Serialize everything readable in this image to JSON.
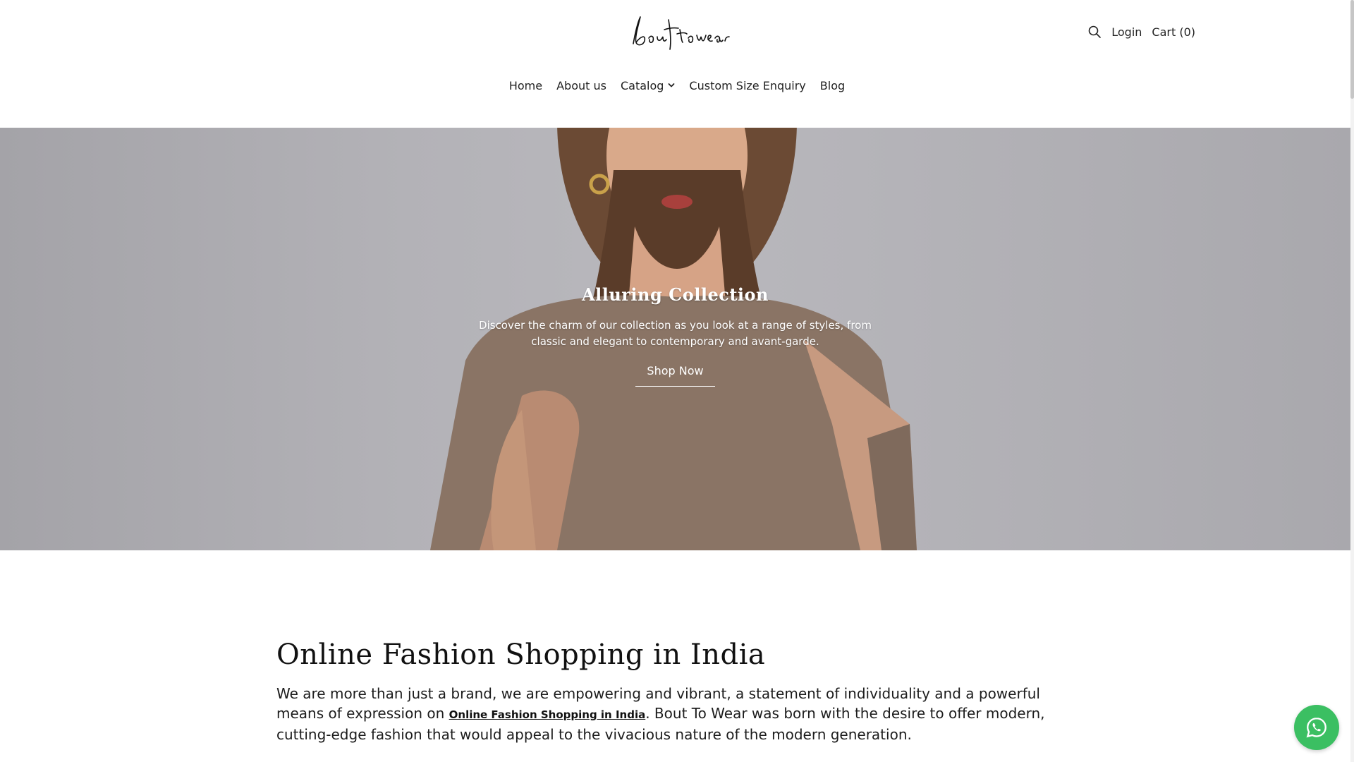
{
  "header": {
    "logo_text": "bout to wear",
    "login_label": "Login",
    "cart_label": "Cart (0)",
    "search_icon": "search-icon"
  },
  "nav": {
    "items": [
      {
        "label": "Home"
      },
      {
        "label": "About us"
      },
      {
        "label": "Catalog",
        "icon": "chevron-down-icon"
      },
      {
        "label": "Custom Size Enquiry"
      },
      {
        "label": "Blog"
      }
    ]
  },
  "hero": {
    "title": "Alluring Collection",
    "text": "Discover the charm of our collection as you look at a range of styles, from classic and elegant to contemporary and avant-garde.",
    "button_label": "Shop Now"
  },
  "intro": {
    "title": "Online Fashion Shopping in India",
    "text_before": "We are more than just a brand, we are empowering and vibrant, a statement of individuality and a powerful means of expression on ",
    "link_label": "Online Fashion Shopping in India",
    "text_after": ". Bout To Wear was born with the desire to offer modern, cutting-edge fashion that would appeal to the vivacious nature of the modern generation."
  },
  "floating": {
    "icon": "whatsapp-icon"
  },
  "colors": {
    "whatsapp": "#3bbf62",
    "hero_bg": "#b3b2b7"
  }
}
